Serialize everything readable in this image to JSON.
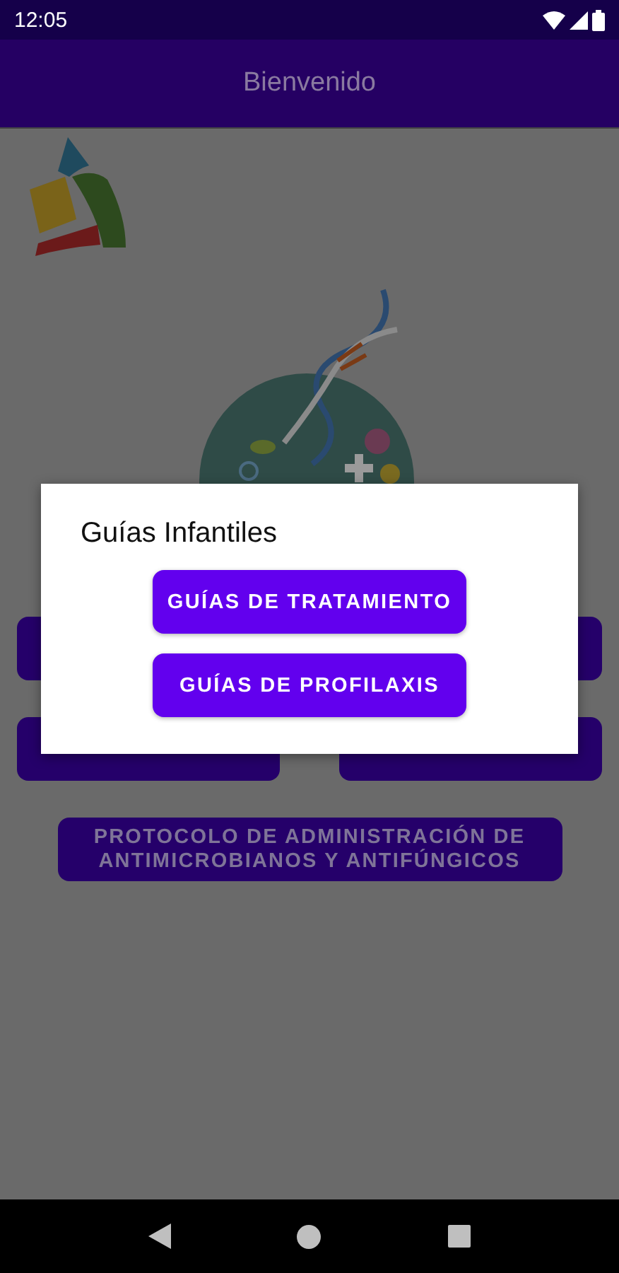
{
  "status_bar": {
    "time": "12:05"
  },
  "app_bar": {
    "title": "Bienvenido"
  },
  "menu_buttons": [
    {
      "kind": "half"
    },
    {
      "kind": "half"
    },
    {
      "kind": "half"
    },
    {
      "kind": "half"
    },
    {
      "kind": "wide",
      "label": "PROTOCOLO DE ADMINISTRACIÓN DE ANTIMICROBIANOS Y ANTIFÚNGICOS"
    }
  ],
  "dialog": {
    "title": "Guías Infantiles",
    "buttons": [
      "GUÍAS DE TRATAMIENTO",
      "GUÍAS DE PROFILAXIS"
    ]
  }
}
